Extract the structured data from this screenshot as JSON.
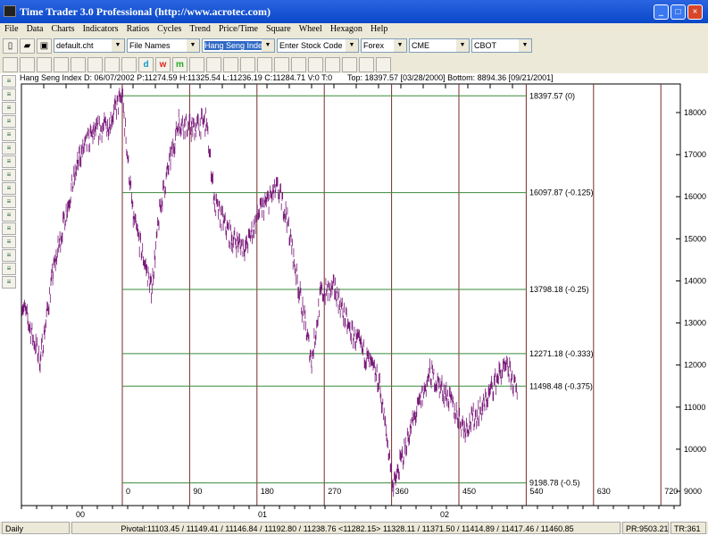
{
  "window": {
    "title": "Time Trader 3.0 Professional (http://www.acrotec.com)",
    "buttons": [
      "_",
      "□",
      "×"
    ]
  },
  "menu": [
    "File",
    "Data",
    "Charts",
    "Indicators",
    "Ratios",
    "Cycles",
    "Trend",
    "Price/Time",
    "Square",
    "Wheel",
    "Hexagon",
    "Help"
  ],
  "toolbar": {
    "combos": [
      {
        "value": "default.cht"
      },
      {
        "value": "File Names"
      },
      {
        "value": "Hang Seng Index",
        "selected": true
      },
      {
        "value": "Enter Stock Code"
      },
      {
        "value": "Forex"
      },
      {
        "value": "CME"
      },
      {
        "value": "CBOT"
      }
    ]
  },
  "tools": [
    "zoom",
    "left",
    "right",
    "up",
    "down",
    "fit",
    "scale",
    "cross",
    "d",
    "w",
    "m",
    "line",
    "t1",
    "t2",
    "gann",
    "fib",
    "bars",
    "check",
    "swing",
    "pencil",
    "clear",
    "brush",
    "camera"
  ],
  "info": {
    "left": "Hang Seng Index  D: 06/07/2002  P:11274.59  H:11325.54  L:11236.19  C:11284.71  V:0  T:0",
    "right": "Top: 18397.57 [03/28/2000]  Bottom: 8894.36 [09/21/2001]"
  },
  "chart_data": {
    "type": "line",
    "series_color": "#7a1a7a",
    "yticks": [
      18000,
      17000,
      16000,
      15000,
      14000,
      13000,
      12000,
      11000,
      10000,
      9000
    ],
    "ylim": [
      8750,
      18800
    ],
    "xticks": [
      {
        "label": "00",
        "year": 2000
      },
      {
        "label": "01",
        "year": 2001
      },
      {
        "label": "02",
        "year": 2002
      }
    ],
    "retracements": [
      {
        "price": 18397.57,
        "label": "18397.57 (0)"
      },
      {
        "price": 16097.87,
        "label": "16097.87 (-0.125)"
      },
      {
        "price": 13798.18,
        "label": "13798.18 (-0.25)"
      },
      {
        "price": 12271.18,
        "label": "12271.18 (-0.333)"
      },
      {
        "price": 11498.48,
        "label": "11498.48 (-0.375)"
      },
      {
        "price": 9198.78,
        "label": "9198.78 (-0.5)"
      }
    ],
    "cycle_labels": [
      "0",
      "90",
      "180",
      "270",
      "360",
      "450",
      "540",
      "630",
      "720"
    ],
    "points": [
      [
        1999.68,
        13500
      ],
      [
        1999.78,
        12100
      ],
      [
        1999.85,
        14200
      ],
      [
        1999.93,
        15800
      ],
      [
        2000.0,
        17000
      ],
      [
        2000.07,
        17500
      ],
      [
        2000.15,
        17700
      ],
      [
        2000.23,
        18400
      ],
      [
        2000.29,
        15500
      ],
      [
        2000.39,
        13800
      ],
      [
        2000.44,
        15800
      ],
      [
        2000.54,
        17800
      ],
      [
        2000.61,
        17600
      ],
      [
        2000.69,
        17800
      ],
      [
        2000.74,
        15800
      ],
      [
        2000.83,
        15000
      ],
      [
        2000.91,
        14800
      ],
      [
        2000.98,
        15600
      ],
      [
        2001.08,
        16200
      ],
      [
        2001.13,
        15600
      ],
      [
        2001.2,
        13800
      ],
      [
        2001.27,
        12100
      ],
      [
        2001.32,
        13700
      ],
      [
        2001.4,
        13800
      ],
      [
        2001.47,
        12900
      ],
      [
        2001.57,
        12200
      ],
      [
        2001.64,
        11600
      ],
      [
        2001.72,
        9100
      ],
      [
        2001.8,
        10300
      ],
      [
        2001.84,
        10800
      ],
      [
        2001.92,
        11800
      ],
      [
        2002.01,
        11300
      ],
      [
        2002.11,
        10500
      ],
      [
        2002.21,
        11000
      ],
      [
        2002.3,
        11800
      ],
      [
        2002.35,
        11900
      ],
      [
        2002.4,
        11300
      ]
    ]
  },
  "status": {
    "period": "Daily",
    "pivotal": "Pivotal:11103.45 / 11149.41 / 11146.84 / 11192.80 / 11238.76 <11282.15> 11328.11 / 11371.50 / 11414.89 / 11417.46 / 11460.85",
    "pr": "PR:9503.21",
    "tr": "TR:361"
  }
}
